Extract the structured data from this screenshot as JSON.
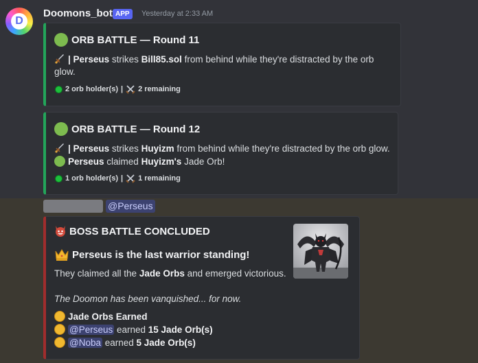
{
  "message": {
    "username": "Doomons_bot",
    "badge": "APP",
    "timestamp": "Yesterday at 2:33 AM",
    "avatar_letter": "D"
  },
  "embeds": [
    {
      "title": "ORB BATTLE — Round 11",
      "line1": {
        "sep": "|",
        "actor": "Perseus",
        "verb": " strikes ",
        "target": "Bill85.sol",
        "rest": " from behind while they're distracted by the orb"
      },
      "line1_wrap": "glow.",
      "footer": {
        "holders": "2 orb holder(s)",
        "sep": "|",
        "remaining": "2 remaining"
      }
    },
    {
      "title": "ORB BATTLE — Round 12",
      "line1": {
        "sep": "|",
        "actor": "Perseus",
        "verb": " strikes ",
        "target": "Huyizm",
        "rest": " from behind while they're distracted by the orb glow."
      },
      "line2": {
        "actor": "Perseus",
        "verb": " claimed ",
        "target": "Huyizm's",
        "rest": " Jade Orb!"
      },
      "footer": {
        "holders": "1 orb holder(s)",
        "sep": "|",
        "remaining": "1 remaining"
      }
    }
  ],
  "mention": {
    "tag": "@Perseus"
  },
  "boss_embed": {
    "title": "BOSS BATTLE CONCLUDED",
    "headline": "Perseus is the last warrior standing!",
    "desc_pre": "They claimed all the ",
    "desc_bold": "Jade Orbs",
    "desc_post": " and emerged victorious.",
    "italic": "The Doomon has been vanquished... for now.",
    "earned_title": "Jade Orbs Earned",
    "earnings": [
      {
        "user": "@Perseus",
        "verb": " earned ",
        "amount": "15 Jade Orb(s)"
      },
      {
        "user": "@Noba",
        "verb": " earned ",
        "amount": "5 Jade Orb(s)"
      }
    ]
  },
  "colors": {
    "green_accent": "#23a55a",
    "red_accent": "#a12d2d",
    "app_badge": "#5865f2",
    "mention_bg": "#3c4270"
  },
  "icons": [
    "dagger-icon",
    "crossed-swords-icon",
    "green-orb-icon",
    "green-dot-icon",
    "demon-icon",
    "crown-icon",
    "coin-icon"
  ]
}
